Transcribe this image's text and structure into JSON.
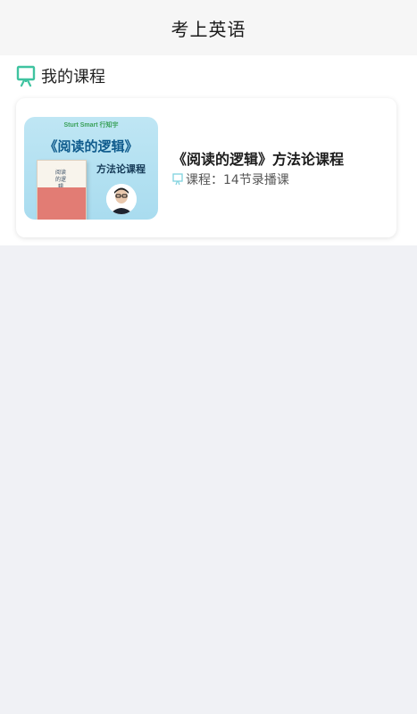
{
  "header": {
    "title": "考上英语"
  },
  "my_courses": {
    "heading": "我的课程",
    "heading_icon": "whiteboard-icon",
    "accent_color": "#3fc3a0",
    "courses": [
      {
        "title": "《阅读的逻辑》方法论课程",
        "meta_label": "课程：",
        "meta_value": "14节录播课",
        "meta_icon": "whiteboard-icon",
        "cover": {
          "brand": "Sturt Smart 行知宇",
          "title": "《阅读的逻辑》",
          "subtitle": "方法论课程",
          "book_text": "阅读的逻辑",
          "background_color": "#b3e0f1",
          "title_color": "#0e5a8c"
        }
      }
    ]
  }
}
